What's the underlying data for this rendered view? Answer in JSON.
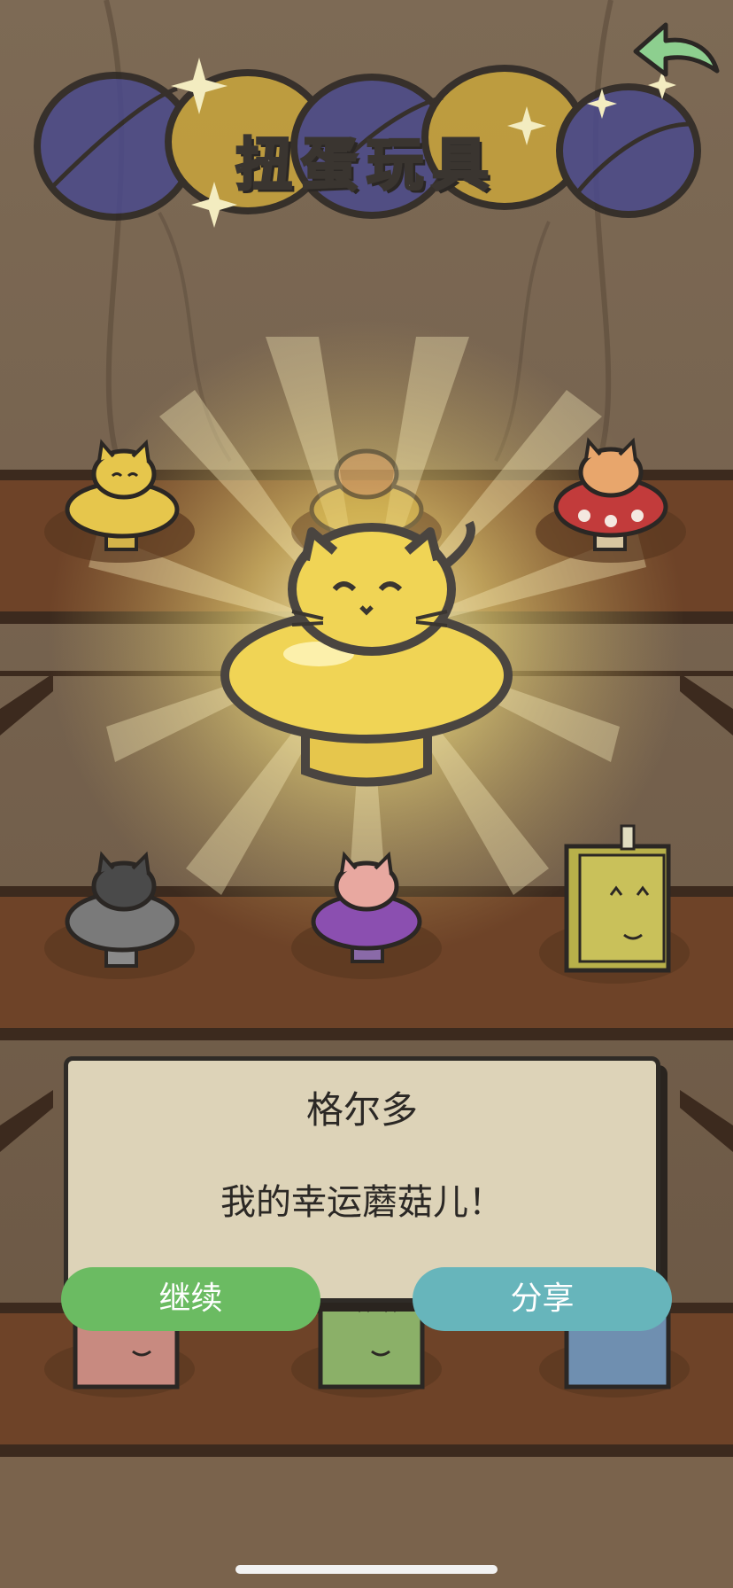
{
  "header": {
    "title": "扭蛋玩具"
  },
  "toys": [
    {
      "id": "yellow-cat-small",
      "emotion": "happy"
    },
    {
      "id": "faded-cat"
    },
    {
      "id": "red-mushroom-cat"
    },
    {
      "id": "gray-cat"
    },
    {
      "id": "purple-cat"
    },
    {
      "id": "yellow-book"
    },
    {
      "id": "pink-book"
    },
    {
      "id": "green-book"
    },
    {
      "id": "blue-book"
    }
  ],
  "dialog": {
    "name": "格尔多",
    "message": "我的幸运蘑菇儿！"
  },
  "buttons": {
    "continue_label": "继续",
    "share_label": "分享"
  },
  "colors": {
    "continue": "#6bbb62",
    "share": "#67b5bb",
    "dialog_bg": "#ddd3b8",
    "shelf": "#6b3f25",
    "wall": "#8a7257"
  },
  "icons": {
    "back": "curved-back-arrow-icon",
    "sparkle": "sparkle-icon"
  }
}
